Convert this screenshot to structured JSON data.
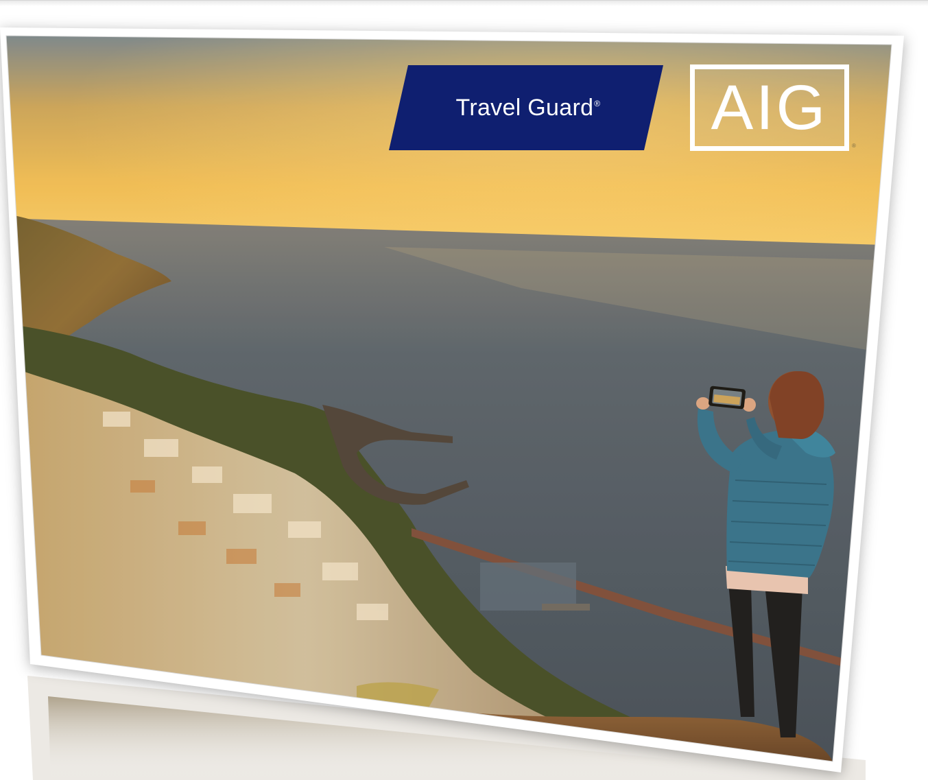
{
  "brand": {
    "product_name": "Travel Guard",
    "product_mark": "®",
    "company_logo": "AIG",
    "company_mark": "®",
    "product_badge_color": "#0f1f70",
    "logo_border_color": "#ffffff"
  },
  "photo": {
    "icons": [
      "coastline-scene",
      "traveler-figure",
      "smartphone-icon"
    ],
    "sky_colors": [
      "#7f90a4",
      "#e9b64a",
      "#f4c35b"
    ],
    "sea_color": "#4f5967",
    "jacket_color": "#2f6f8d"
  }
}
